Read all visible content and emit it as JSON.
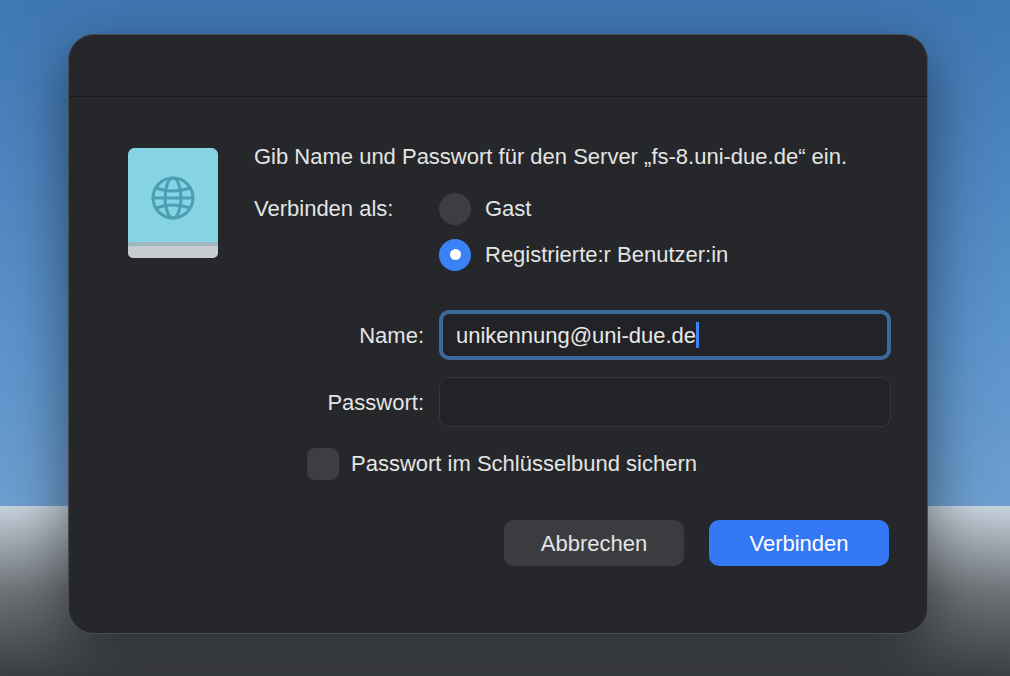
{
  "dialog": {
    "prompt": "Gib Name und Passwort für den Server „fs-8.uni-due.de“ ein.",
    "connect_as": {
      "label": "Verbinden als:",
      "options": [
        {
          "label": "Gast",
          "selected": false
        },
        {
          "label": "Registrierte:r Benutzer:in",
          "selected": true
        }
      ]
    },
    "fields": [
      {
        "label": "Name:",
        "value": "unikennung@uni-due.de",
        "focused": true
      },
      {
        "label": "Passwort:",
        "value": "",
        "focused": false
      }
    ],
    "keychain": {
      "label": "Passwort im Schlüsselbund sichern",
      "checked": false
    },
    "buttons": [
      {
        "label": "Abbrechen",
        "default": false
      },
      {
        "label": "Verbinden",
        "default": true
      }
    ]
  }
}
